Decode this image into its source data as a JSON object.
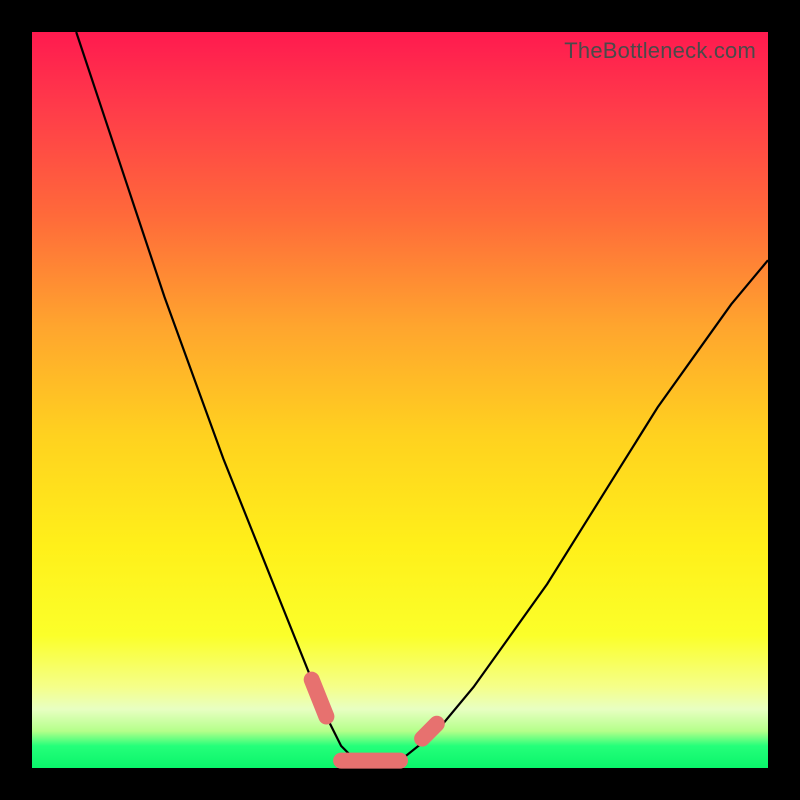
{
  "watermark": "TheBottleneck.com",
  "colors": {
    "frame": "#000000",
    "curve": "#000000",
    "marker": "#e7716f",
    "gradient_top": "#ff1a4f",
    "gradient_bottom": "#09f56a"
  },
  "chart_data": {
    "type": "line",
    "title": "",
    "xlabel": "",
    "ylabel": "",
    "xlim": [
      0,
      100
    ],
    "ylim": [
      0,
      100
    ],
    "grid": false,
    "legend": false,
    "series": [
      {
        "name": "bottleneck-curve",
        "x": [
          6,
          10,
          14,
          18,
          22,
          26,
          30,
          34,
          38,
          40,
          42,
          44,
          46,
          48,
          50,
          55,
          60,
          65,
          70,
          75,
          80,
          85,
          90,
          95,
          100
        ],
        "y": [
          100,
          88,
          76,
          64,
          53,
          42,
          32,
          22,
          12,
          7,
          3,
          1,
          0,
          0,
          1,
          5,
          11,
          18,
          25,
          33,
          41,
          49,
          56,
          63,
          69
        ]
      },
      {
        "name": "highlight-segments",
        "segments": [
          {
            "x": [
              38,
              40
            ],
            "y": [
              12,
              7
            ]
          },
          {
            "x": [
              42,
              50
            ],
            "y": [
              1,
              1
            ]
          },
          {
            "x": [
              53,
              55
            ],
            "y": [
              4,
              6
            ]
          }
        ]
      }
    ],
    "notes": "y-values estimated from position of curve against gradient; axis has no tick labels in image"
  }
}
